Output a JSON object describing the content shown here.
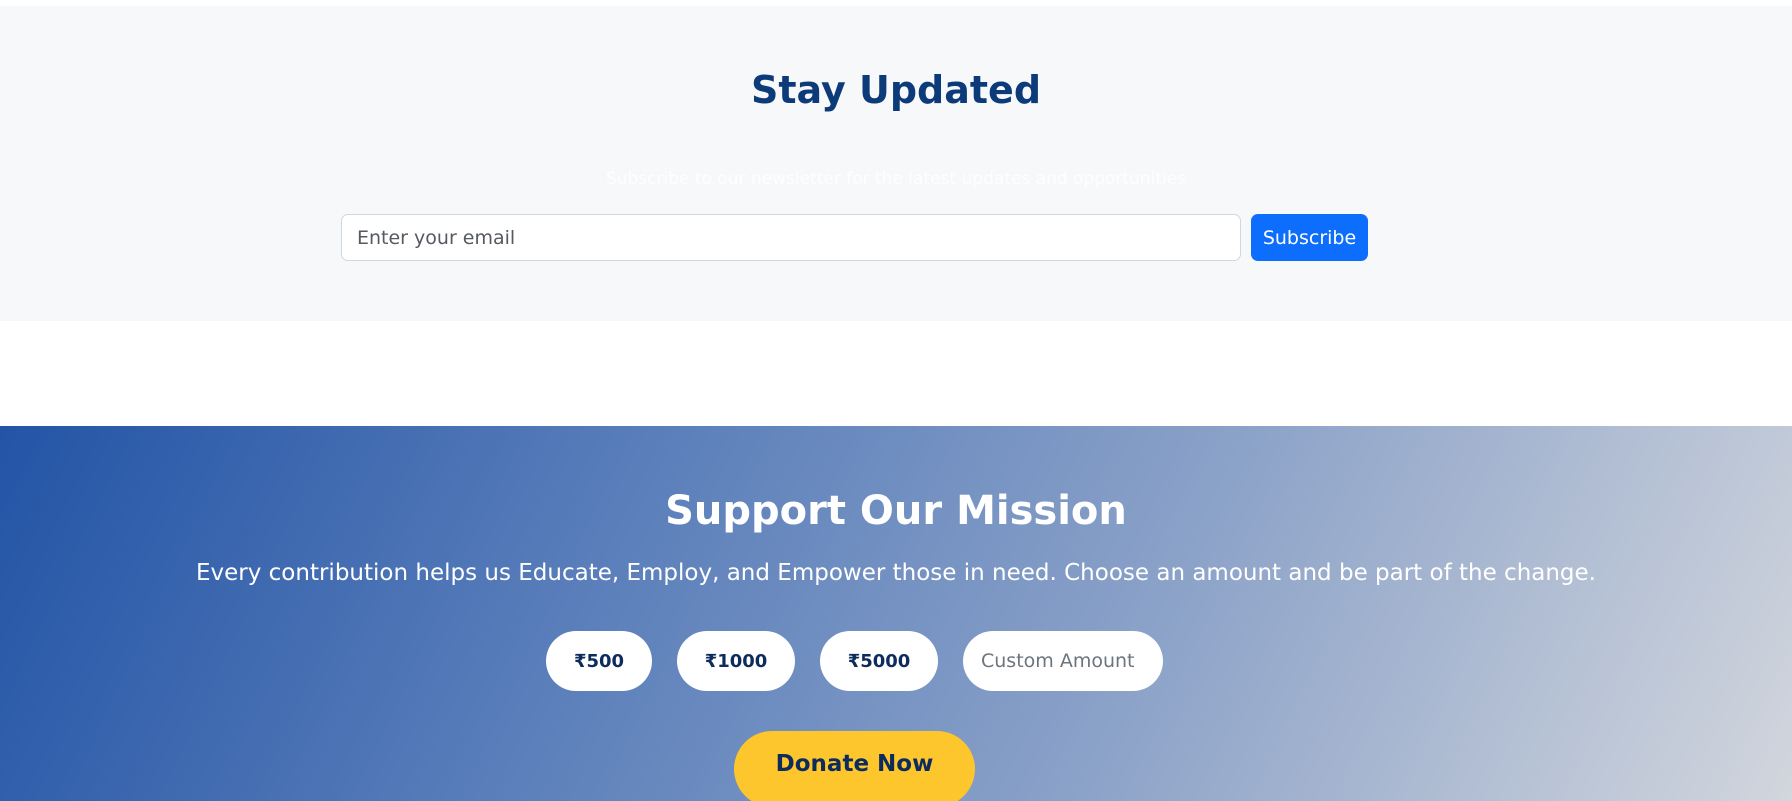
{
  "newsletter": {
    "title": "Stay Updated",
    "subtitle": "Subscribe to our newsletter for the latest updates and opportunities",
    "email_placeholder": "Enter your email",
    "subscribe_label": "Subscribe"
  },
  "donation": {
    "title": "Support Our Mission",
    "description": "Every contribution helps us Educate, Employ, and Empower those in need. Choose an amount and be part of the change.",
    "amounts": [
      "₹500",
      "₹1000",
      "₹5000"
    ],
    "custom_placeholder": "Custom Amount",
    "donate_label": "Donate Now"
  },
  "colors": {
    "heading_blue": "#0d3b7a",
    "primary_button": "#0d6efd",
    "donate_yellow": "#fcc62c",
    "gradient_start": "#2354a6",
    "gradient_end": "#d2d6dd"
  }
}
